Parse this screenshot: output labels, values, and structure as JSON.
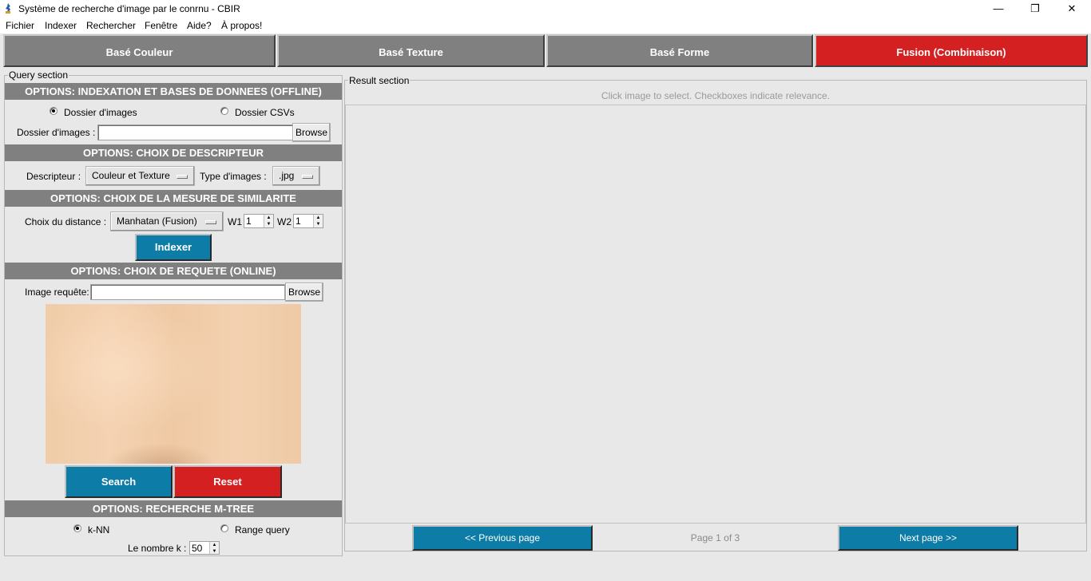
{
  "window": {
    "title": "Système de recherche d'image par le conrnu - CBIR",
    "minimize_glyph": "—",
    "restore_glyph": "❐",
    "close_glyph": "✕"
  },
  "menu": [
    "Fichier",
    "Indexer",
    "Rechercher",
    "Fenêtre",
    "Aide?",
    "À propos!"
  ],
  "tabs": [
    {
      "label": "Basé Couleur",
      "active": false
    },
    {
      "label": "Basé Texture",
      "active": false
    },
    {
      "label": "Basé Forme",
      "active": false
    },
    {
      "label": "Fusion (Combinaison)",
      "active": true
    }
  ],
  "query": {
    "frame_label": "Query section",
    "indexation": {
      "header": "OPTIONS: INDEXATION ET BASES DE DONNEES (OFFLINE)",
      "radio_images": "Dossier d'images",
      "radio_csv": "Dossier CSVs",
      "selected": "images",
      "folder_label": "Dossier d'images :",
      "folder_value": "",
      "browse": "Browse"
    },
    "descripteur": {
      "header": "OPTIONS: CHOIX DE DESCRIPTEUR",
      "label": "Descripteur :",
      "value": "Couleur et Texture",
      "type_label": "Type d'images :",
      "type_value": ".jpg"
    },
    "similarite": {
      "header": "OPTIONS: CHOIX DE LA MESURE DE SIMILARITE",
      "label": "Choix du distance :",
      "value": "Manhatan (Fusion)",
      "w1_label": "W1",
      "w1_value": "1",
      "w2_label": "W2",
      "w2_value": "1",
      "indexer_button": "Indexer"
    },
    "requete": {
      "header": "OPTIONS: CHOIX DE REQUETE (ONLINE)",
      "label": "Image requête:",
      "value": "",
      "browse": "Browse",
      "search_button": "Search",
      "reset_button": "Reset"
    },
    "mtree": {
      "header": "OPTIONS: RECHERCHE M-TREE",
      "radio_knn": "k-NN",
      "radio_range": "Range query",
      "selected": "knn",
      "k_label": "Le nombre k :",
      "k_value": "50"
    }
  },
  "results": {
    "frame_label": "Result section",
    "hint": "Click image to select. Checkboxes indicate relevance.",
    "prev_button": "<< Previous page",
    "page_info": "Page 1 of 3",
    "next_button": "Next page >>"
  },
  "colors": {
    "accent_blue": "#0d7ca7",
    "accent_red": "#d42020",
    "header_gray": "#808080"
  }
}
